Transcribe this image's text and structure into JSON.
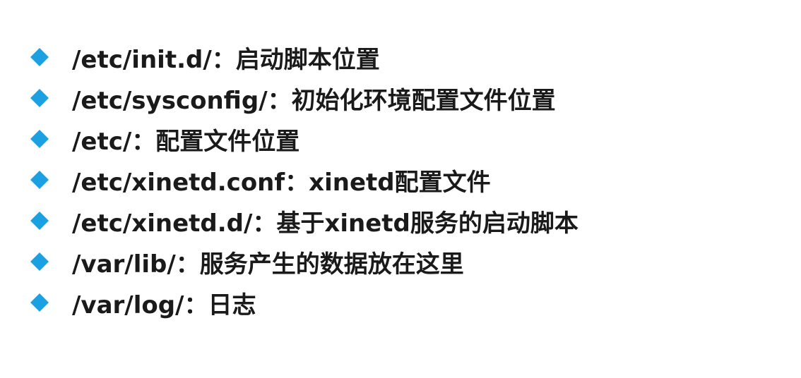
{
  "slide": {
    "bullet_color": "#1BA1E2",
    "text_color": "#1a1a1a",
    "items": [
      {
        "text": "/etc/init.d/：启动脚本位置",
        "icon": "diamond-bullet-icon"
      },
      {
        "text": "/etc/sysconfig/：初始化环境配置文件位置",
        "icon": "diamond-bullet-icon"
      },
      {
        "text": "/etc/：配置文件位置",
        "icon": "diamond-bullet-icon"
      },
      {
        "text": "/etc/xinetd.conf：xinetd配置文件",
        "icon": "diamond-bullet-icon"
      },
      {
        "text": "/etc/xinetd.d/：基于xinetd服务的启动脚本",
        "icon": "diamond-bullet-icon"
      },
      {
        "text": "/var/lib/：服务产生的数据放在这里",
        "icon": "diamond-bullet-icon"
      },
      {
        "text": "/var/log/：日志",
        "icon": "diamond-bullet-icon"
      }
    ]
  }
}
